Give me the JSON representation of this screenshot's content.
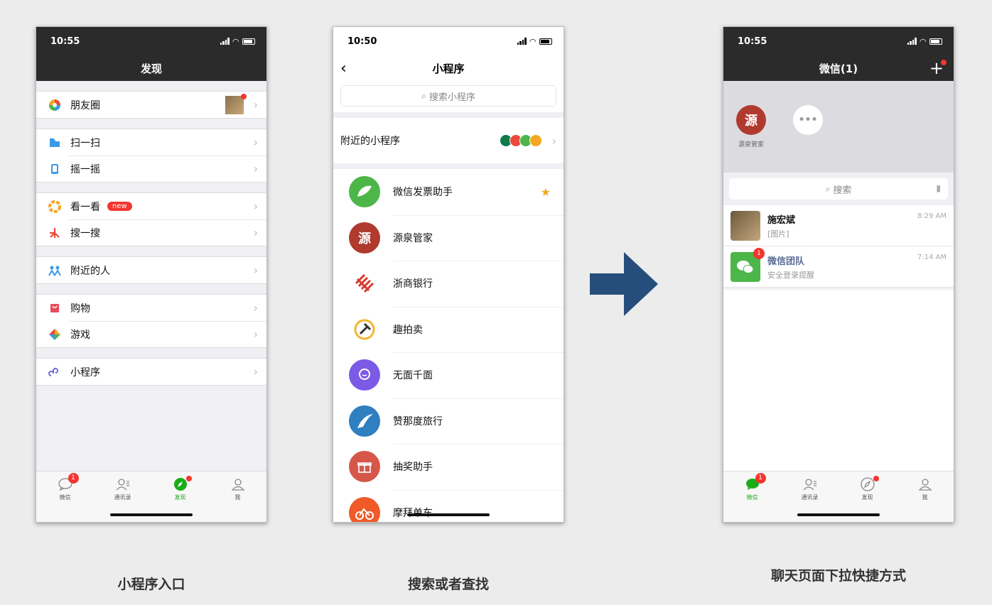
{
  "phone1": {
    "time": "10:55",
    "title": "发现",
    "groups": [
      [
        {
          "label": "朋友圈",
          "icon": "moments-icon"
        }
      ],
      [
        {
          "label": "扫一扫",
          "icon": "scan-icon"
        },
        {
          "label": "摇一摇",
          "icon": "shake-icon"
        }
      ],
      [
        {
          "label": "看一看",
          "icon": "top-stories-icon",
          "badge": "new"
        },
        {
          "label": "搜一搜",
          "icon": "search-icon"
        }
      ],
      [
        {
          "label": "附近的人",
          "icon": "people-nearby-icon"
        }
      ],
      [
        {
          "label": "购物",
          "icon": "shopping-icon"
        },
        {
          "label": "游戏",
          "icon": "games-icon"
        }
      ],
      [
        {
          "label": "小程序",
          "icon": "mini-program-icon"
        }
      ]
    ]
  },
  "phone2": {
    "time": "10:50",
    "title": "小程序",
    "search_placeholder": "搜索小程序",
    "nearby_label": "附近的小程序",
    "items": [
      {
        "label": "微信发票助手",
        "color": "#4cb648",
        "starred": true
      },
      {
        "label": "源泉管家",
        "color": "#b03a2e"
      },
      {
        "label": "浙商银行",
        "color": "#d63b2f"
      },
      {
        "label": "趣拍卖",
        "color": "#f2b630"
      },
      {
        "label": "无面千面",
        "color": "#7b5be6"
      },
      {
        "label": "赞那度旅行",
        "color": "#2f7fc1"
      },
      {
        "label": "抽奖助手",
        "color": "#d6574a"
      },
      {
        "label": "摩拜单车",
        "color": "#f05a28"
      }
    ]
  },
  "phone3": {
    "time": "10:55",
    "title": "微信(1)",
    "pulldown_label": "源泉管家",
    "search_placeholder": "搜索",
    "chats": [
      {
        "name": "施宏斌",
        "preview": "[图片]",
        "time": "8:29 AM"
      },
      {
        "name": "微信团队",
        "preview": "安全登录提醒",
        "time": "7:14 AM",
        "badge": "1"
      }
    ]
  },
  "tabs": {
    "chats": "微信",
    "contacts": "通讯录",
    "discover": "发现",
    "me": "我",
    "chats_badge": "1"
  },
  "captions": {
    "c1": "小程序入口",
    "c2": "搜索或者查找",
    "c3": "聊天页面下拉快捷方式"
  },
  "colors": {
    "wechat_green": "#1aad19",
    "arrow": "#254e7c",
    "badge_red": "#f43530"
  }
}
